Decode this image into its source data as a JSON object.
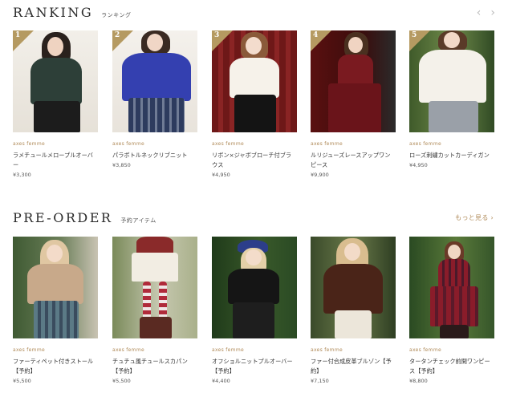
{
  "ranking": {
    "title": "RANKING",
    "subtitle": "ランキング",
    "prev_icon": "chevron-left-icon",
    "next_icon": "chevron-right-icon",
    "prev_glyph": "‹",
    "next_glyph": "›",
    "items": [
      {
        "rank": "1",
        "brand": "axes femme",
        "name": "ラメチュールメロープルオーバー",
        "price": "¥3,300"
      },
      {
        "rank": "2",
        "brand": "axes femme",
        "name": "パラボトルネックリブニット",
        "price": "¥3,850"
      },
      {
        "rank": "3",
        "brand": "axes femme",
        "name": "リボン×ジャボブローチ付ブラウス",
        "price": "¥4,950"
      },
      {
        "rank": "4",
        "brand": "axes femme",
        "name": "ルリジューズレースアップワンピース",
        "price": "¥9,900"
      },
      {
        "rank": "5",
        "brand": "axes femme",
        "name": "ローズ刺繍カットカーディガン",
        "price": "¥4,950"
      }
    ]
  },
  "preorder": {
    "title": "PRE-ORDER",
    "subtitle": "予約アイテム",
    "more_label": "もっと見る ›",
    "items": [
      {
        "brand": "axes femme",
        "name": "ファーティペット付きストール【予約】",
        "price": "¥5,500"
      },
      {
        "brand": "axes femme",
        "name": "チュチュ風チュールスカパン【予約】",
        "price": "¥5,500"
      },
      {
        "brand": "axes femme",
        "name": "オフショルニットプルオーバー【予約】",
        "price": "¥4,400"
      },
      {
        "brand": "axes femme",
        "name": "ファー付合成皮革ブルゾン【予約】",
        "price": "¥7,150"
      },
      {
        "brand": "axes femme",
        "name": "タータンチェック前開ワンピース【予約】",
        "price": "¥8,800"
      }
    ]
  },
  "colors": {
    "accent": "#b08b5a",
    "badge": "#b59a61"
  }
}
